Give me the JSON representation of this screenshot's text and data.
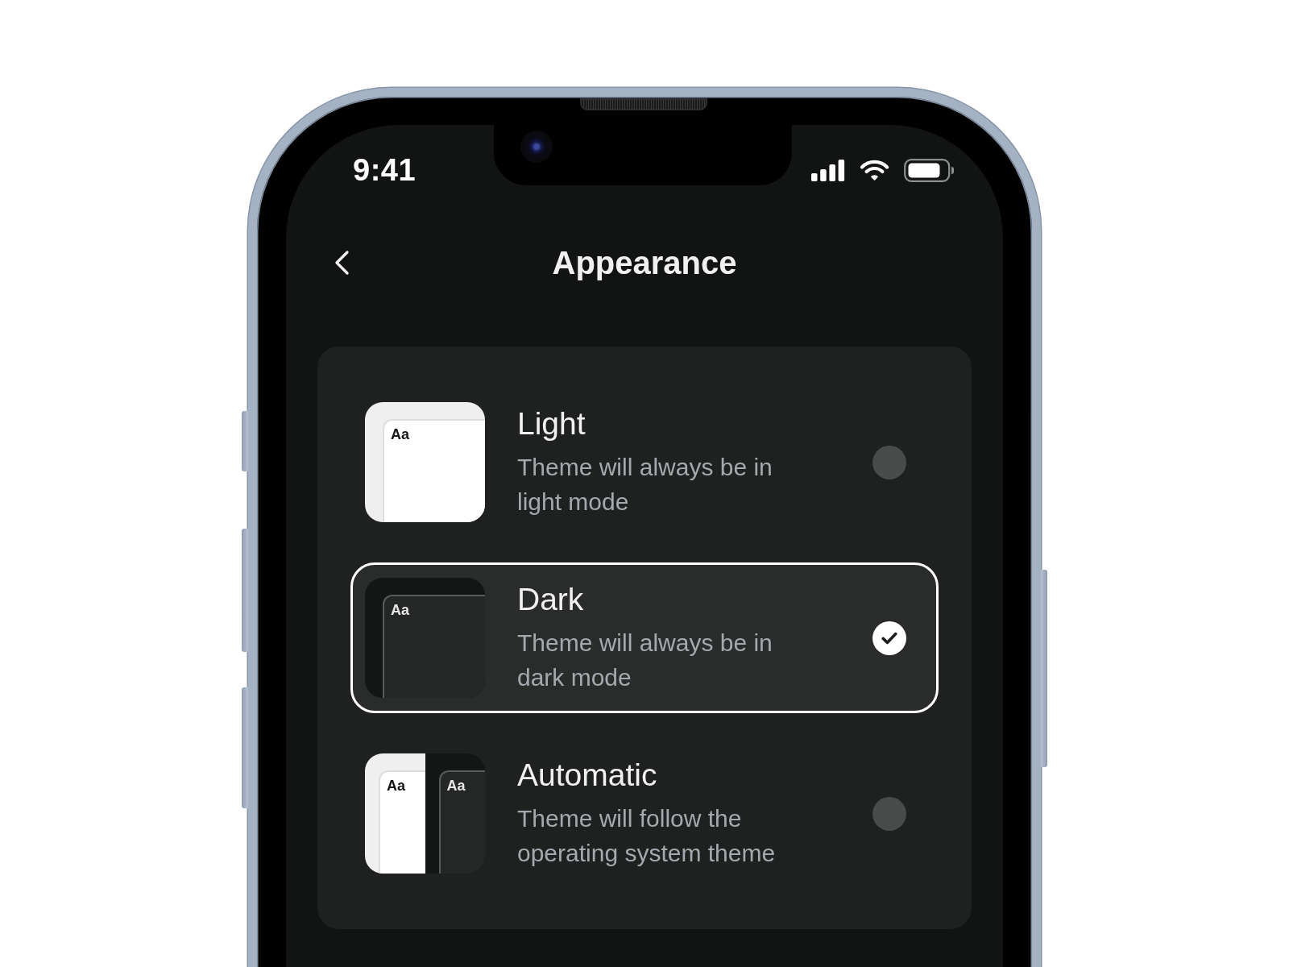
{
  "status_bar": {
    "time": "9:41"
  },
  "header": {
    "title": "Appearance"
  },
  "options": [
    {
      "title": "Light",
      "description": "Theme will always be in light mode",
      "selected": false,
      "preview": [
        {
          "kind": "light",
          "label": "Aa"
        }
      ]
    },
    {
      "title": "Dark",
      "description": "Theme will always be in dark mode",
      "selected": true,
      "preview": [
        {
          "kind": "dark",
          "label": "Aa"
        }
      ]
    },
    {
      "title": "Automatic",
      "description": "Theme will follow the operating system theme",
      "selected": false,
      "preview": [
        {
          "kind": "light",
          "label": "Aa"
        },
        {
          "kind": "dark",
          "label": "Aa"
        }
      ]
    }
  ]
}
